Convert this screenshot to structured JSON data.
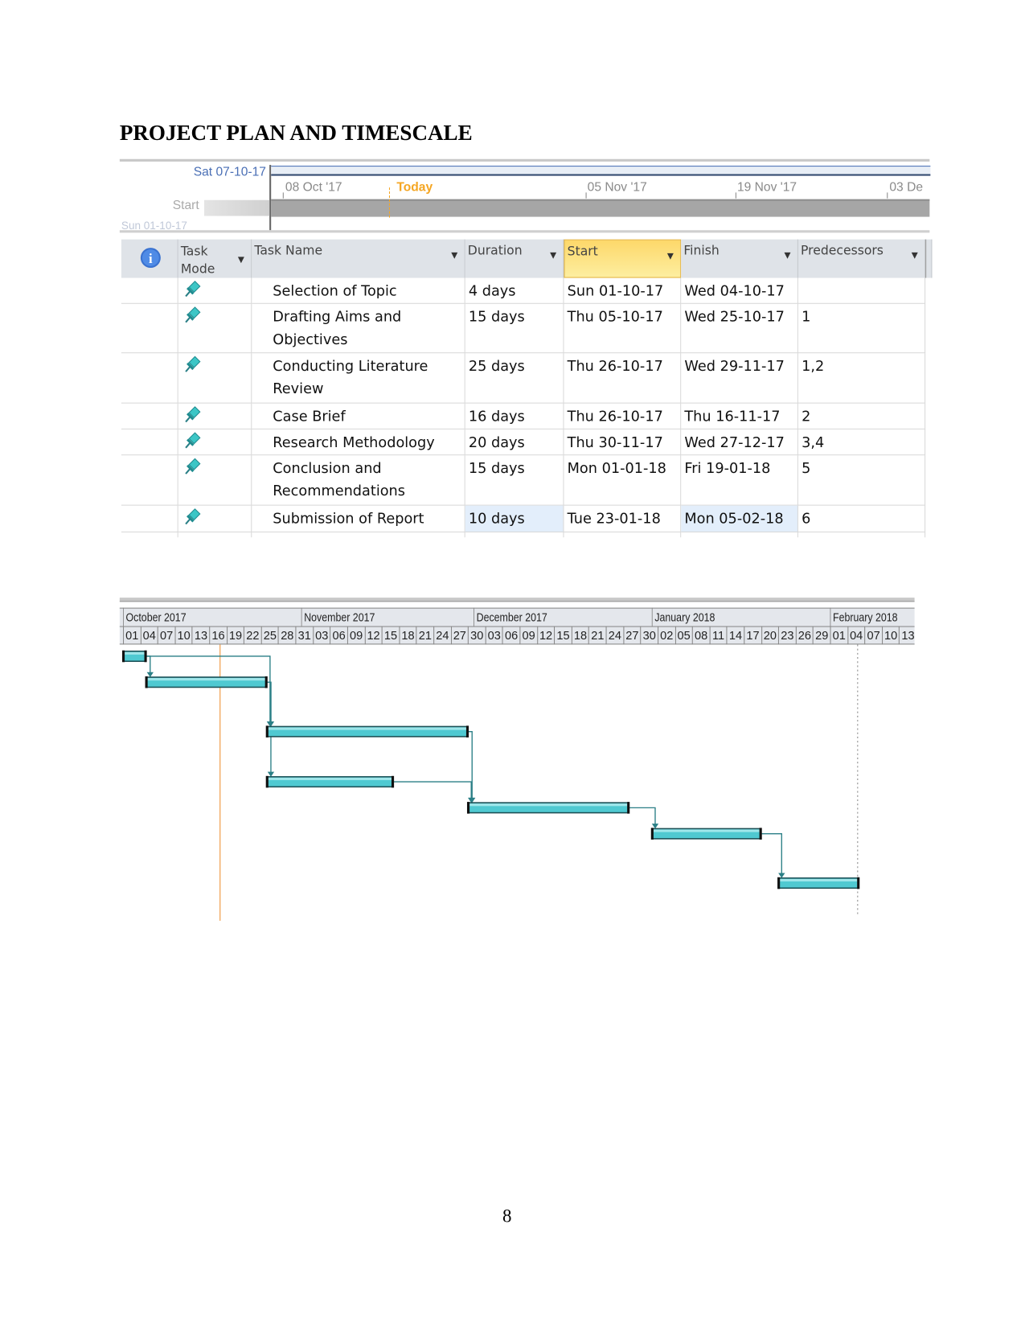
{
  "title": "PROJECT PLAN AND TIMESCALE",
  "timeline": {
    "current_date": "Sat 07-10-17",
    "start_label": "Start",
    "start_date": "Sun 01-10-17",
    "ticks": [
      "08 Oct '17",
      "Today",
      "05 Nov '17",
      "19 Nov '17",
      "03 De"
    ]
  },
  "table": {
    "columns": [
      "Task Mode",
      "Task Name",
      "Duration",
      "Start",
      "Finish",
      "Predecessors"
    ],
    "info_icon": "info-icon",
    "sorted_column_color": "#fde27a",
    "rows": [
      {
        "name": "Selection of Topic",
        "duration": "4 days",
        "start": "Sun 01-10-17",
        "finish": "Wed 04-10-17",
        "pred": ""
      },
      {
        "name": "Drafting Aims and Objectives",
        "duration": "15 days",
        "start": "Thu 05-10-17",
        "finish": "Wed 25-10-17",
        "pred": "1"
      },
      {
        "name": "Conducting Literature Review",
        "duration": "25 days",
        "start": "Thu 26-10-17",
        "finish": "Wed 29-11-17",
        "pred": "1,2"
      },
      {
        "name": "Case Brief",
        "duration": "16 days",
        "start": "Thu 26-10-17",
        "finish": "Thu 16-11-17",
        "pred": "2"
      },
      {
        "name": "Research Methodology",
        "duration": "20 days",
        "start": "Thu 30-11-17",
        "finish": "Wed 27-12-17",
        "pred": "3,4"
      },
      {
        "name": "Conclusion and Recommendations",
        "duration": "15 days",
        "start": "Mon 01-01-18",
        "finish": "Fri 19-01-18",
        "pred": "5"
      },
      {
        "name": "Submission of Report",
        "duration": "10 days",
        "start": "Tue 23-01-18",
        "finish": "Mon 05-02-18",
        "pred": "6"
      }
    ]
  },
  "gantt": {
    "months": [
      "October 2017",
      "November 2017",
      "December 2017",
      "January 2018",
      "February 2018"
    ],
    "days": [
      "01",
      "04",
      "07",
      "10",
      "13",
      "16",
      "19",
      "22",
      "25",
      "28",
      "31",
      "03",
      "06",
      "09",
      "12",
      "15",
      "18",
      "21",
      "24",
      "27",
      "30",
      "03",
      "06",
      "09",
      "12",
      "15",
      "18",
      "21",
      "24",
      "27",
      "30",
      "02",
      "05",
      "08",
      "11",
      "14",
      "17",
      "20",
      "23",
      "26",
      "29",
      "01",
      "04",
      "07",
      "10",
      "13"
    ],
    "bar_color": "#4fc9d1",
    "link_color": "#2a7f86",
    "today_line_color": "#f0a050"
  },
  "page_number": "8"
}
